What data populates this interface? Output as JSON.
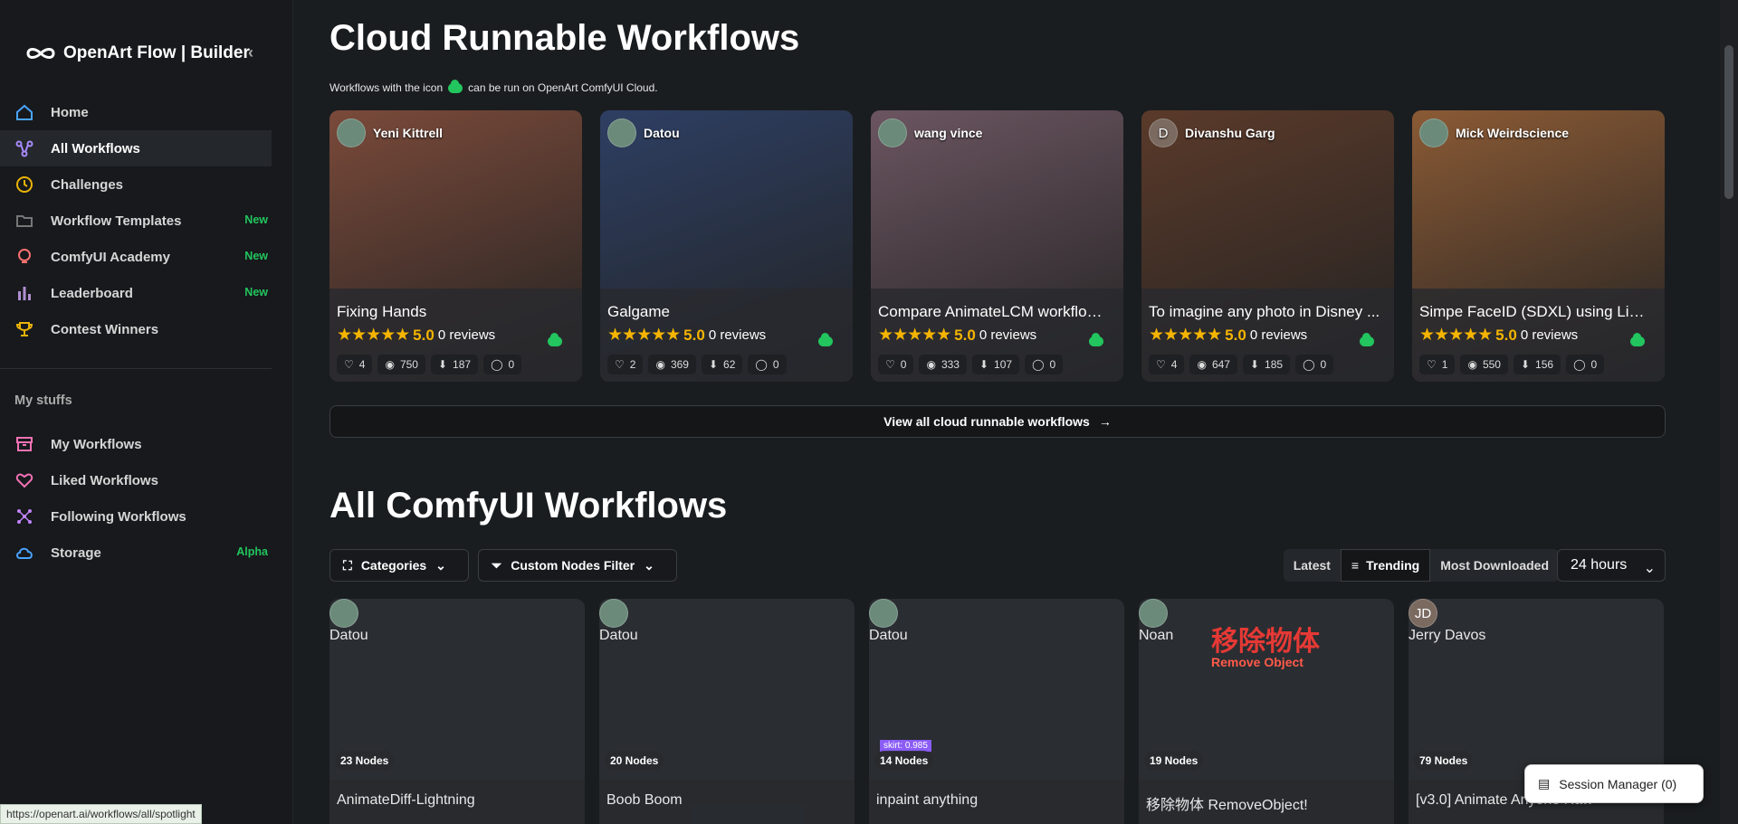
{
  "brand": {
    "title": "OpenArt Flow | Builder"
  },
  "sidebar": {
    "items": [
      {
        "label": "Home",
        "tag": "",
        "icon": "home-icon",
        "active": false
      },
      {
        "label": "All Workflows",
        "tag": "",
        "icon": "workflow-icon",
        "active": true
      },
      {
        "label": "Challenges",
        "tag": "",
        "icon": "clock-icon",
        "active": false
      },
      {
        "label": "Workflow Templates",
        "tag": "New",
        "icon": "folder-icon",
        "active": false
      },
      {
        "label": "ComfyUI Academy",
        "tag": "New",
        "icon": "bulb-icon",
        "active": false
      },
      {
        "label": "Leaderboard",
        "tag": "New",
        "icon": "bar-chart-icon",
        "active": false
      },
      {
        "label": "Contest Winners",
        "tag": "",
        "icon": "trophy-icon",
        "active": false
      }
    ],
    "section_label": "My stuffs",
    "my_items": [
      {
        "label": "My Workflows",
        "tag": "",
        "icon": "archive-icon"
      },
      {
        "label": "Liked Workflows",
        "tag": "",
        "icon": "heart-icon"
      },
      {
        "label": "Following Workflows",
        "tag": "",
        "icon": "nodes-icon"
      },
      {
        "label": "Storage",
        "tag": "Alpha",
        "icon": "cloud-icon"
      }
    ]
  },
  "cloud_section": {
    "title": "Cloud Runnable Workflows",
    "note_before": "Workflows with the icon",
    "note_after": "can be run on OpenArt ComfyUI Cloud.",
    "view_all": "View all cloud runnable workflows",
    "cards": [
      {
        "author": "Yeni Kittrell",
        "title": "Fixing Hands",
        "rating": "5.0",
        "reviews": "0 reviews",
        "likes": "4",
        "views": "750",
        "downloads": "187",
        "comments": "0",
        "color": "#7a4a3a"
      },
      {
        "author": "Datou",
        "title": "Galgame",
        "rating": "5.0",
        "reviews": "0 reviews",
        "likes": "2",
        "views": "369",
        "downloads": "62",
        "comments": "0",
        "color": "#2e3f63"
      },
      {
        "author": "wang vince",
        "title": "Compare AnimateLCM workflow...",
        "rating": "5.0",
        "reviews": "0 reviews",
        "likes": "0",
        "views": "333",
        "downloads": "107",
        "comments": "0",
        "color": "#6b5560"
      },
      {
        "author": "Divanshu Garg",
        "title": "To imagine any photo in Disney ...",
        "rating": "5.0",
        "reviews": "0 reviews",
        "likes": "4",
        "views": "647",
        "downloads": "185",
        "comments": "0",
        "color": "#5a3a2a",
        "avatar_letter": "D"
      },
      {
        "author": "Mick Weirdscience",
        "title": "Simpe FaceID (SDXL) using Ligh...",
        "rating": "5.0",
        "reviews": "0 reviews",
        "likes": "1",
        "views": "550",
        "downloads": "156",
        "comments": "0",
        "color": "#8a5a35"
      }
    ]
  },
  "all_section": {
    "title": "All ComfyUI Workflows",
    "categories": "Categories",
    "custom_nodes": "Custom Nodes Filter",
    "sort": [
      "Latest",
      "Trending",
      "Most Downloaded"
    ],
    "period": "24 hours",
    "cards": [
      {
        "author": "Datou",
        "nodes": "23 Nodes",
        "title": "AnimateDiff-Lightning",
        "color": "#8a4a50"
      },
      {
        "author": "Datou",
        "nodes": "20 Nodes",
        "title": "Boob Boom",
        "color": "#b89a8a"
      },
      {
        "author": "Datou",
        "nodes": "14 Nodes",
        "title": "inpaint anything",
        "color": "#9aa0b8",
        "overlay": "skirt: 0.985"
      },
      {
        "author": "Noan",
        "nodes": "19 Nodes",
        "title": "移除物体 RemoveObject!",
        "color": "#2a2a30",
        "overlay": "移除物体",
        "overlay2": "Remove Object"
      },
      {
        "author": "Jerry Davos",
        "nodes": "79 Nodes",
        "title": "[v3.0] Animate Anyone Raw",
        "color": "#c8c8c8",
        "avatar_letter": "JD"
      }
    ]
  },
  "status_url": "https://openart.ai/workflows/all/spotlight",
  "session": "Session Manager (0)"
}
